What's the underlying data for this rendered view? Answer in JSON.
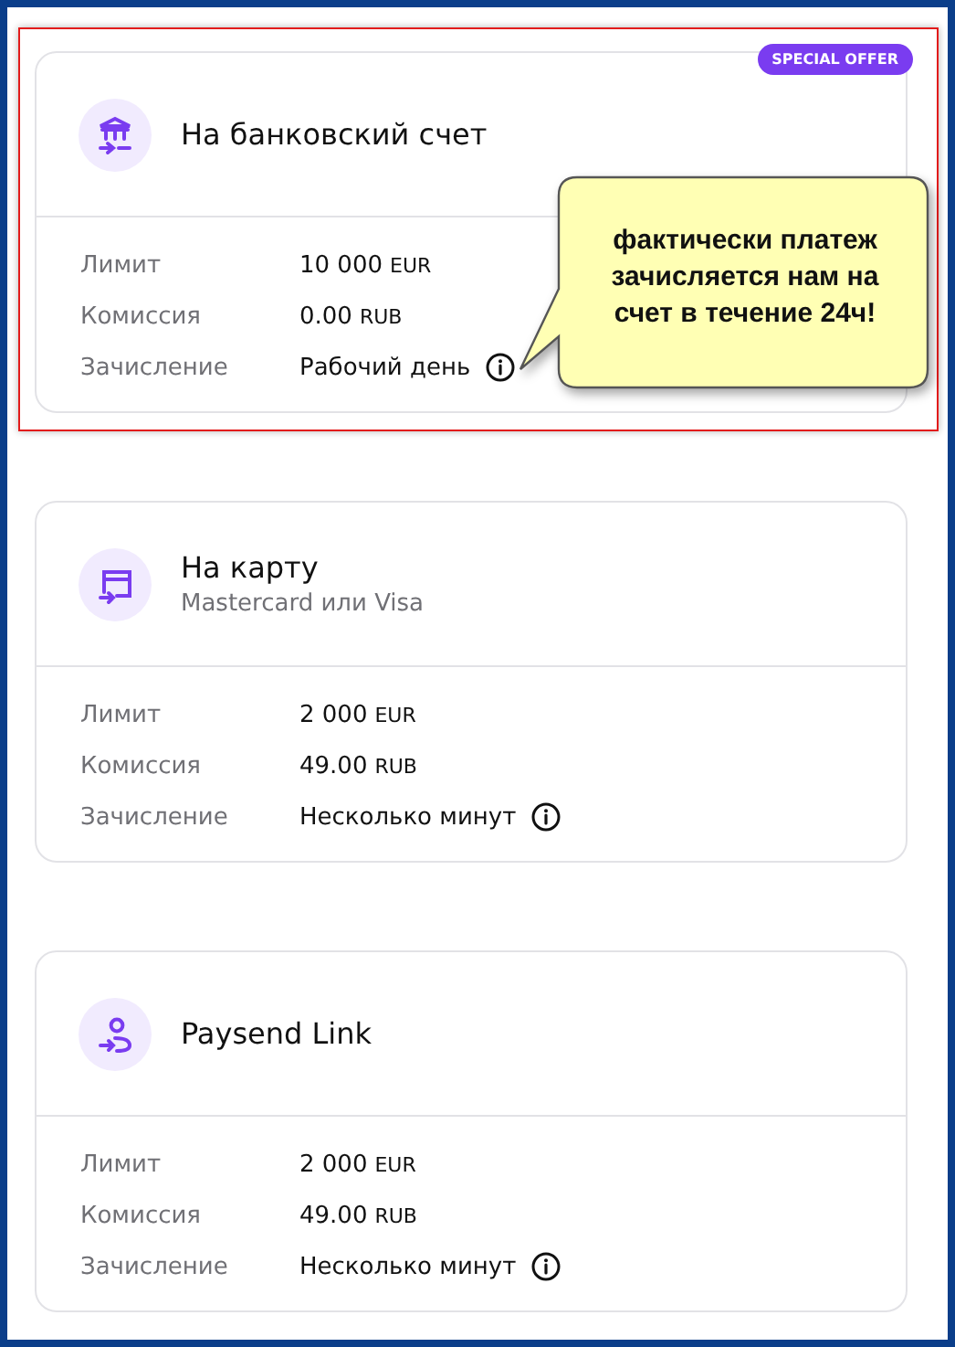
{
  "cards": [
    {
      "kind": "bank",
      "title": "На банковский счет",
      "badge": "SPECIAL OFFER",
      "highlighted": true,
      "rows": [
        {
          "label": "Лимит",
          "value": "10 000",
          "unit": "EUR"
        },
        {
          "label": "Комиссия",
          "value": "0.00",
          "unit": "RUB"
        },
        {
          "label": "Зачисление",
          "value": "Рабочий день",
          "info": true
        }
      ]
    },
    {
      "kind": "card",
      "title": "На карту",
      "subtitle": "Mastercard или Visa",
      "rows": [
        {
          "label": "Лимит",
          "value": "2 000",
          "unit": "EUR"
        },
        {
          "label": "Комиссия",
          "value": "49.00",
          "unit": "RUB"
        },
        {
          "label": "Зачисление",
          "value": "Несколько минут",
          "info": true
        }
      ]
    },
    {
      "kind": "link",
      "title": "Paysend Link",
      "rows": [
        {
          "label": "Лимит",
          "value": "2 000",
          "unit": "EUR"
        },
        {
          "label": "Комиссия",
          "value": "49.00",
          "unit": "RUB"
        },
        {
          "label": "Зачисление",
          "value": "Несколько минут",
          "info": true
        }
      ]
    }
  ],
  "callout": {
    "text": "фактически платеж зачисляется нам на счет в течение 24ч!"
  }
}
